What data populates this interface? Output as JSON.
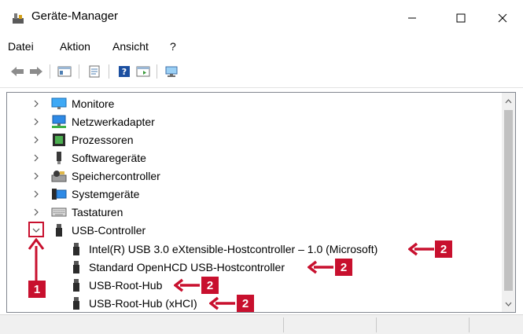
{
  "window": {
    "title": "Geräte-Manager"
  },
  "menu": {
    "items": [
      "Datei",
      "Aktion",
      "Ansicht",
      "?"
    ]
  },
  "tree": {
    "categories": [
      {
        "label": "Monitore",
        "expanded": false
      },
      {
        "label": "Netzwerkadapter",
        "expanded": false
      },
      {
        "label": "Prozessoren",
        "expanded": false
      },
      {
        "label": "Softwaregeräte",
        "expanded": false
      },
      {
        "label": "Speichercontroller",
        "expanded": false
      },
      {
        "label": "Systemgeräte",
        "expanded": false
      },
      {
        "label": "Tastaturen",
        "expanded": false
      },
      {
        "label": "USB-Controller",
        "expanded": true
      }
    ],
    "usb_children": [
      "Intel(R) USB 3.0 eXtensible-Hostcontroller – 1.0 (Microsoft)",
      "Standard OpenHCD USB-Hostcontroller",
      "USB-Root-Hub",
      "USB-Root-Hub (xHCI)"
    ]
  },
  "annotations": {
    "badge_1": "1",
    "badge_2": "2"
  },
  "colors": {
    "annotation": "#c8102e",
    "selection": "#0078d7"
  }
}
